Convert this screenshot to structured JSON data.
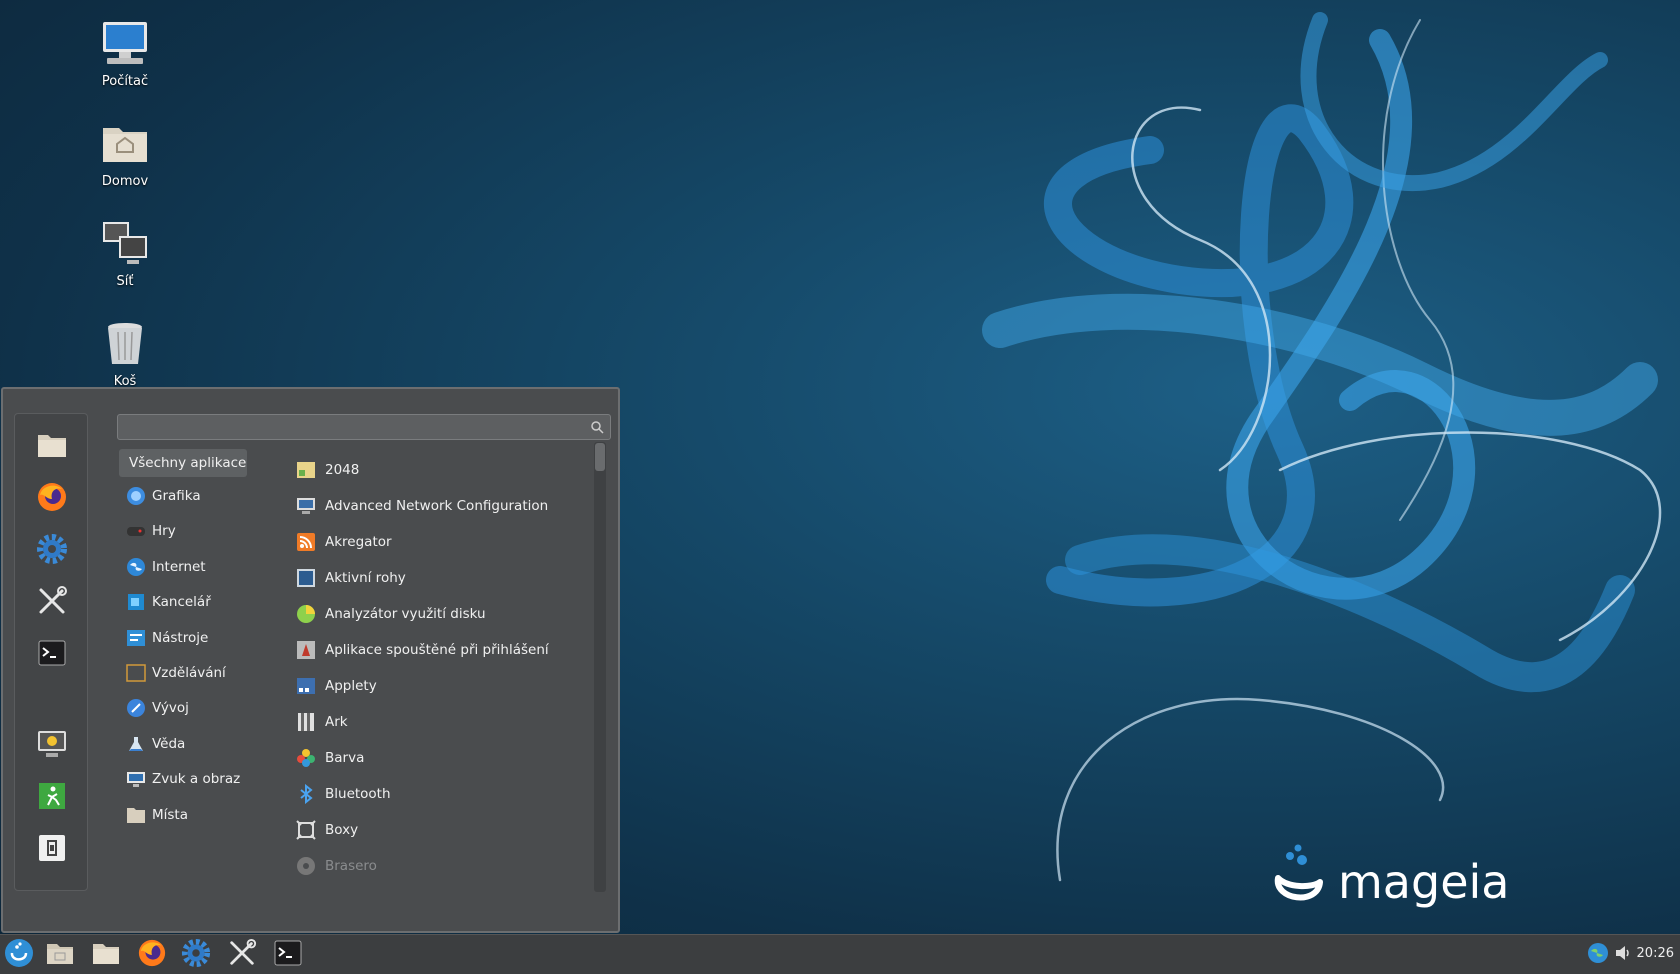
{
  "desktop": {
    "icons": [
      {
        "label": "Počítač"
      },
      {
        "label": "Domov"
      },
      {
        "label": "Síť"
      },
      {
        "label": "Koš"
      }
    ],
    "brand_text": "mageia"
  },
  "menu": {
    "search_placeholder": "",
    "categories": [
      {
        "label": "Všechny aplikace"
      },
      {
        "label": "Grafika"
      },
      {
        "label": "Hry"
      },
      {
        "label": "Internet"
      },
      {
        "label": "Kancelář"
      },
      {
        "label": "Nástroje"
      },
      {
        "label": "Vzdělávání"
      },
      {
        "label": "Vývoj"
      },
      {
        "label": "Věda"
      },
      {
        "label": "Zvuk a obraz"
      },
      {
        "label": "Místa"
      }
    ],
    "apps": [
      {
        "label": "2048"
      },
      {
        "label": "Advanced Network Configuration"
      },
      {
        "label": "Akregator"
      },
      {
        "label": "Aktivní rohy"
      },
      {
        "label": "Analyzátor využití disku"
      },
      {
        "label": "Aplikace spouštěné při přihlášení"
      },
      {
        "label": "Applety"
      },
      {
        "label": "Ark"
      },
      {
        "label": "Barva"
      },
      {
        "label": "Bluetooth"
      },
      {
        "label": "Boxy"
      },
      {
        "label": "Brasero"
      }
    ],
    "favorites": [
      "files-icon",
      "firefox-icon",
      "settings-icon",
      "tools-icon",
      "terminal-icon",
      "lock-screen-icon",
      "logout-icon",
      "shutdown-icon"
    ]
  },
  "taskbar": {
    "clock": "20:26"
  },
  "colors": {
    "menu_bg": "#4a4c4e",
    "taskbar_bg": "#3c3e40",
    "accent": "#2f8fd6"
  }
}
